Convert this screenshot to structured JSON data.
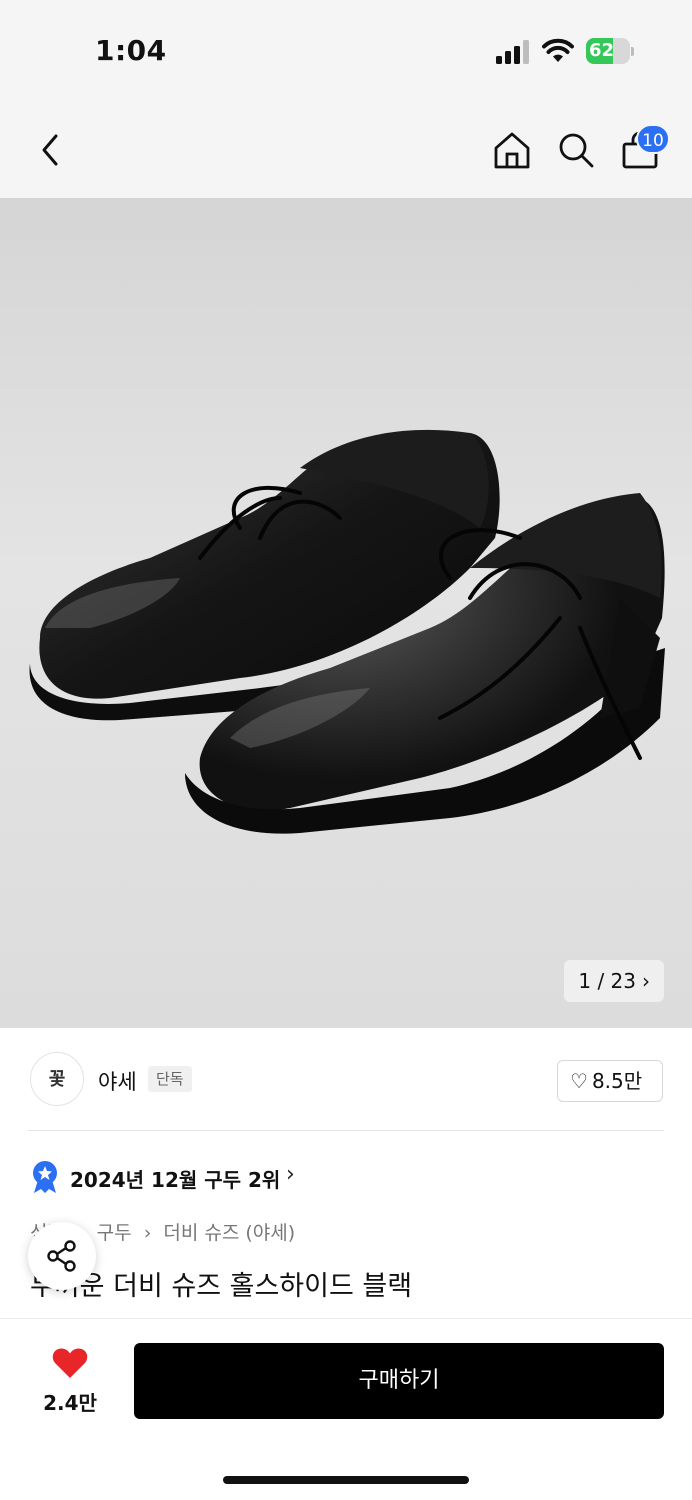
{
  "status_bar": {
    "time": "1:04",
    "battery_level": "62",
    "battery_charging": true,
    "icons": [
      "signal-icon",
      "wifi-icon",
      "battery-icon"
    ]
  },
  "nav": {
    "icons": [
      "back-icon",
      "home-icon",
      "search-icon",
      "shopping-bag-icon"
    ],
    "cart_count": "10",
    "badge_color": "#2b6ff2"
  },
  "image": {
    "counter": "1 / 23",
    "current": 1,
    "total": 23
  },
  "brand": {
    "logo_text": "꽃",
    "name": "야세",
    "tag": "단독",
    "like_count": "8.5만"
  },
  "ranking": {
    "text": "2024년 12월 구두 2위",
    "icon": "ranking-badge-icon",
    "color": "#2b6ff2"
  },
  "breadcrumb": [
    "신발",
    "구두",
    "더비 슈즈 (야세)"
  ],
  "product": {
    "title": "두꺼운 더비 슈즈 홀스하이드 블랙"
  },
  "bottom_bar": {
    "wish_count": "2.4만",
    "wish_color": "#e8262a",
    "buy_label": "구매하기",
    "share_icon": "share-icon"
  }
}
